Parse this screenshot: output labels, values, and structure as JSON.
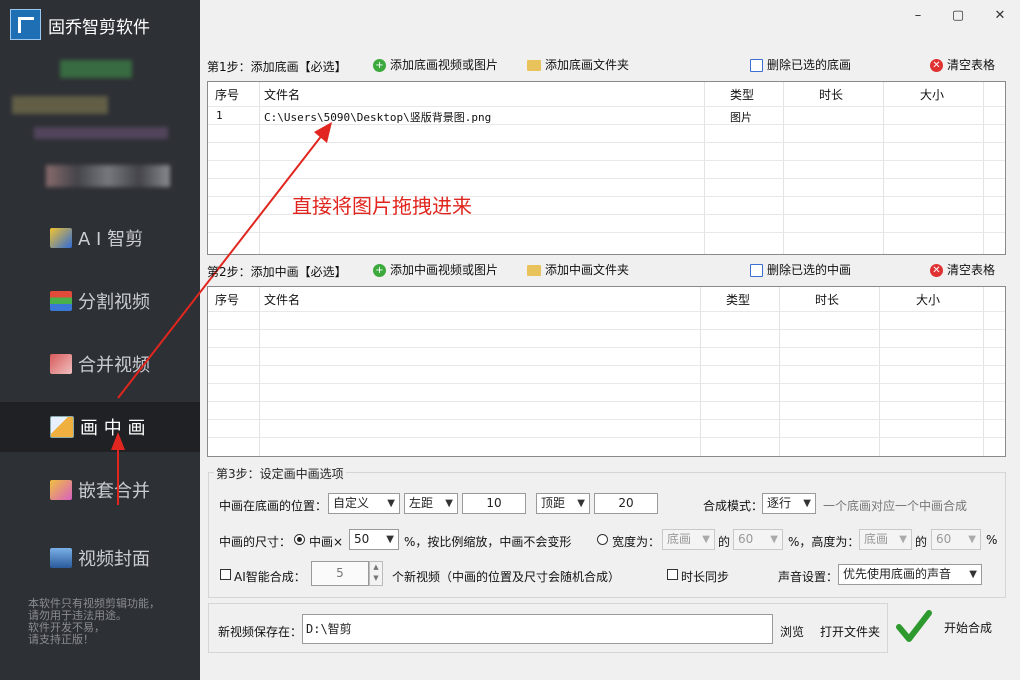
{
  "app": {
    "title": "固乔智剪软件"
  },
  "window": {
    "minimize": "–",
    "maximize": "▢",
    "close": "✕"
  },
  "sidebar": {
    "items": [
      {
        "label": "A I 智剪",
        "icon": "ai-edit-icon",
        "active": false
      },
      {
        "label": "分割视频",
        "icon": "split-video-icon",
        "active": false
      },
      {
        "label": "合并视频",
        "icon": "merge-video-icon",
        "active": false
      },
      {
        "label": "画 中 画",
        "icon": "pip-icon",
        "active": true
      },
      {
        "label": "嵌套合并",
        "icon": "nest-merge-icon",
        "active": false
      },
      {
        "label": "视频封面",
        "icon": "video-cover-icon",
        "active": false
      }
    ],
    "note": [
      "本软件只有视频剪辑功能，",
      "请勿用于违法用途。",
      "软件开发不易，",
      "请支持正版！"
    ]
  },
  "step1": {
    "label": "第1步：添加底画【必选】",
    "add_media": "添加底画视频或图片",
    "add_folder": "添加底画文件夹",
    "delete_selected": "删除已选的底画",
    "clear": "清空表格",
    "columns": [
      "序号",
      "文件名",
      "类型",
      "时长",
      "大小"
    ],
    "rows": [
      {
        "index": "1",
        "filename": "C:\\Users\\5090\\Desktop\\竖版背景图.png",
        "type": "图片",
        "duration": "",
        "size": ""
      }
    ]
  },
  "annotation": "直接将图片拖拽进来",
  "step2": {
    "label": "第2步：添加中画【必选】",
    "add_media": "添加中画视频或图片",
    "add_folder": "添加中画文件夹",
    "delete_selected": "删除已选的中画",
    "clear": "清空表格",
    "columns": [
      "序号",
      "文件名",
      "类型",
      "时长",
      "大小"
    ]
  },
  "step3": {
    "title": "第3步：设定画中画选项",
    "position_label": "中画在底画的位置：",
    "position_value": "自定义",
    "horiz_value": "左距",
    "horiz_amount": "10",
    "vert_value": "顶距",
    "vert_amount": "20",
    "mode_label": "合成模式：",
    "mode_value": "逐行",
    "mode_hint": "一个底画对应一个中画合成",
    "size_label": "中画的尺寸：",
    "size_opt1": "中画×",
    "size_scale": "50",
    "size_hint": "%，按比例缩放，中画不会变形",
    "size_opt2": "宽度为：",
    "width_ref": "底画",
    "of1": "的",
    "width_pct": "60",
    "height_label": "%，高度为：",
    "height_ref": "底画",
    "of2": "的",
    "height_pct": "60",
    "pct": "%",
    "ai_label": "AI智能合成：",
    "ai_count": "5",
    "ai_hint": "个新视频（中画的位置及尺寸会随机合成）",
    "sync_label": "时长同步",
    "sound_label": "声音设置：",
    "sound_value": "优先使用底画的声音"
  },
  "output": {
    "label": "新视频保存在：",
    "path": "D:\\智剪",
    "browse": "浏览",
    "open_folder": "打开文件夹",
    "start": "开始合成"
  }
}
